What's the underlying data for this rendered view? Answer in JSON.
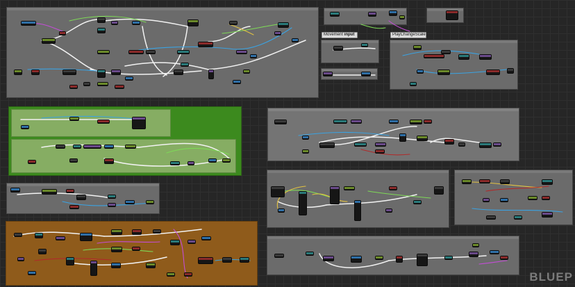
{
  "editor": {
    "labels": {
      "movement_input": "Movement",
      "movement_input_badge": "input",
      "change_scale": "PlayChangeScale"
    },
    "watermark": "BLUEP"
  },
  "colors": {
    "background": "#262626",
    "comment_gray": "#6b6b6b",
    "comment_green": "#3c8a1e",
    "comment_green_inner": "#86ad63",
    "comment_orange": "#8f5b1b",
    "node_body": "#161616",
    "exec_wire": "#f2f2f2",
    "float_wire": "#7ed957",
    "object_wire": "#3aa3e3",
    "vector_wire": "#e3c242",
    "struct_wire": "#c34dd6",
    "bool_wire": "#9b2020"
  },
  "node_header_colors": [
    "#2f6fa6",
    "#6b8a2a",
    "#8a2a2a",
    "#3a3a3a",
    "#2a7a7a",
    "#6a4a8a"
  ]
}
